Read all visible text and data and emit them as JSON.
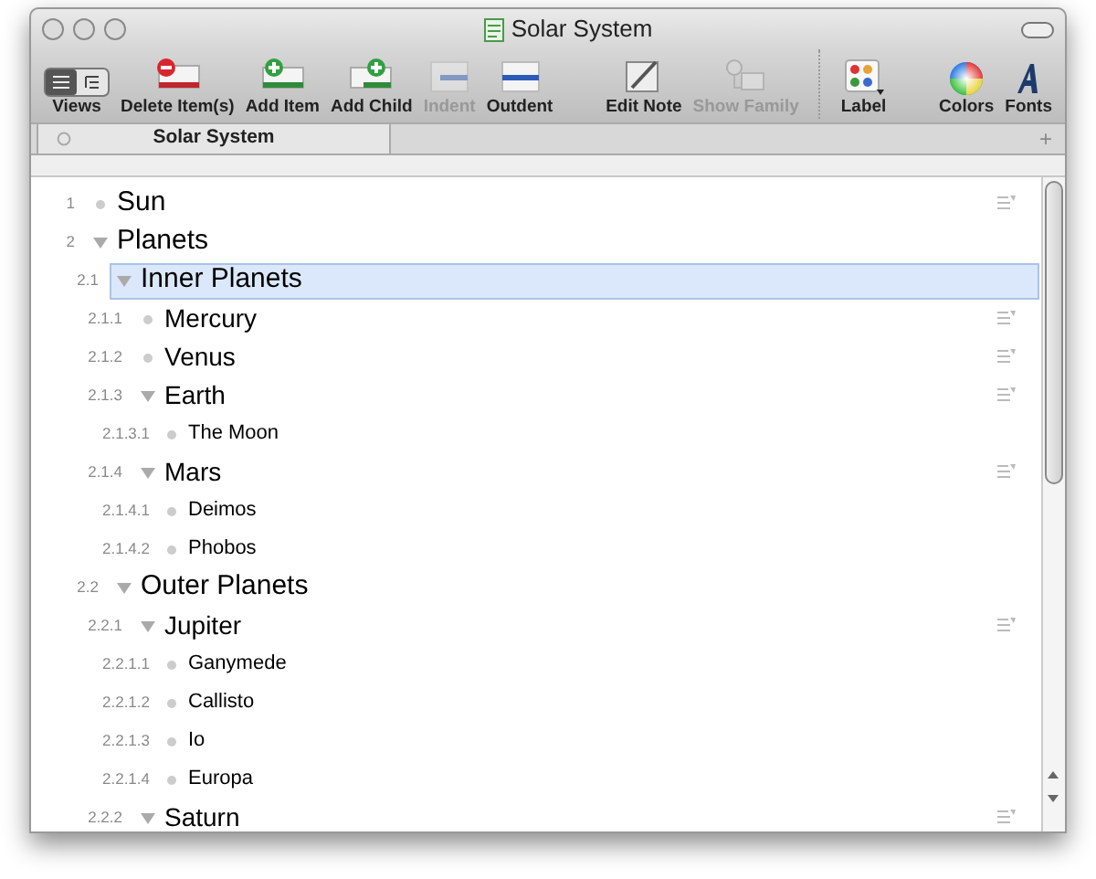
{
  "window": {
    "title": "Solar System"
  },
  "toolbar": [
    {
      "kind": "views",
      "label": "Views",
      "enabled": true
    },
    {
      "kind": "delete",
      "label": "Delete Item(s)",
      "enabled": true
    },
    {
      "kind": "add",
      "label": "Add Item",
      "enabled": true
    },
    {
      "kind": "add_child",
      "label": "Add Child",
      "enabled": true
    },
    {
      "kind": "indent",
      "label": "Indent",
      "enabled": false
    },
    {
      "kind": "outdent",
      "label": "Outdent",
      "enabled": true
    },
    {
      "kind": "spacer"
    },
    {
      "kind": "edit_note",
      "label": "Edit Note",
      "enabled": true
    },
    {
      "kind": "show_family",
      "label": "Show Family",
      "enabled": false
    },
    {
      "kind": "separator"
    },
    {
      "kind": "label",
      "label": "Label",
      "enabled": true
    },
    {
      "kind": "spacer"
    },
    {
      "kind": "colors",
      "label": "Colors",
      "enabled": true
    },
    {
      "kind": "fonts",
      "label": "Fonts",
      "enabled": true
    }
  ],
  "tabs": [
    {
      "label": "Solar System",
      "selected": true
    }
  ],
  "tab_bar": {
    "add_symbol": "+"
  },
  "outline": [
    {
      "number": "1",
      "text": "Sun",
      "note": true,
      "selected": false
    },
    {
      "number": "2",
      "text": "Planets",
      "note": false,
      "selected": false,
      "expanded": true,
      "children": [
        {
          "number": "2.1",
          "text": "Inner Planets",
          "note": false,
          "selected": true,
          "expanded": true,
          "children": [
            {
              "number": "2.1.1",
              "text": "Mercury",
              "note": true,
              "selected": false
            },
            {
              "number": "2.1.2",
              "text": "Venus",
              "note": true,
              "selected": false
            },
            {
              "number": "2.1.3",
              "text": "Earth",
              "note": true,
              "selected": false,
              "expanded": true,
              "children": [
                {
                  "number": "2.1.3.1",
                  "text": "The Moon",
                  "note": false,
                  "selected": false
                }
              ]
            },
            {
              "number": "2.1.4",
              "text": "Mars",
              "note": true,
              "selected": false,
              "expanded": true,
              "children": [
                {
                  "number": "2.1.4.1",
                  "text": "Deimos",
                  "note": false,
                  "selected": false
                },
                {
                  "number": "2.1.4.2",
                  "text": "Phobos",
                  "note": false,
                  "selected": false
                }
              ]
            }
          ]
        },
        {
          "number": "2.2",
          "text": "Outer Planets",
          "note": false,
          "selected": false,
          "expanded": true,
          "children": [
            {
              "number": "2.2.1",
              "text": "Jupiter",
              "note": true,
              "selected": false,
              "expanded": true,
              "children": [
                {
                  "number": "2.2.1.1",
                  "text": "Ganymede",
                  "note": false,
                  "selected": false
                },
                {
                  "number": "2.2.1.2",
                  "text": "Callisto",
                  "note": false,
                  "selected": false
                },
                {
                  "number": "2.2.1.3",
                  "text": "Io",
                  "note": false,
                  "selected": false
                },
                {
                  "number": "2.2.1.4",
                  "text": "Europa",
                  "note": false,
                  "selected": false
                }
              ]
            },
            {
              "number": "2.2.2",
              "text": "Saturn",
              "note": true,
              "selected": false,
              "expanded": true
            }
          ]
        }
      ]
    }
  ]
}
